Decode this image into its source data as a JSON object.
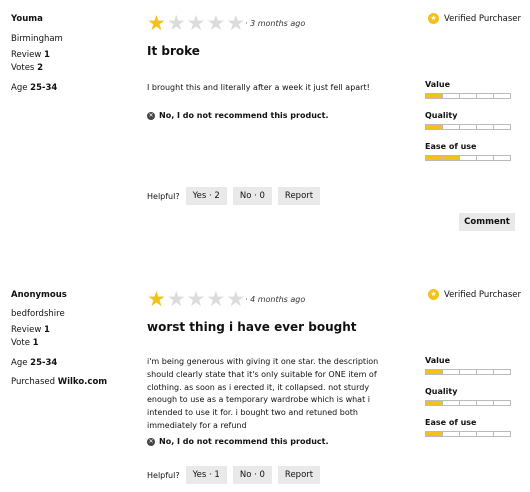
{
  "reviews": [
    {
      "author": "Youma",
      "location": "Birmingham",
      "review_label": "Review",
      "review_count": "1",
      "votes_label": "Votes",
      "votes_count": "2",
      "age_label": "Age",
      "age_value": "25-34",
      "rating": 1,
      "rating_max": 5,
      "time_ago": "· 3 months ago",
      "verified_label": "Verified Purchaser",
      "title": "It broke",
      "body": "I brought this and literally after a week it just fell apart!",
      "recommendation": "No,  I do not recommend this product.",
      "sub_ratings": [
        {
          "label": "Value",
          "level": 1,
          "max": 5
        },
        {
          "label": "Quality",
          "level": 1,
          "max": 5
        },
        {
          "label": "Ease of use",
          "level": 2,
          "max": 5
        }
      ],
      "helpful_label": "Helpful?",
      "yes_label": "Yes · 2",
      "no_label": "No · 0",
      "report_label": "Report",
      "comment_label": "Comment"
    },
    {
      "author": "Anonymous",
      "location": "bedfordshire",
      "review_label": "Review",
      "review_count": "1",
      "votes_label": "Vote",
      "votes_count": "1",
      "age_label": "Age",
      "age_value": "25-34",
      "purchased_label": "Purchased",
      "purchased_value": "Wilko.com",
      "rating": 1,
      "rating_max": 5,
      "time_ago": "· 4 months ago",
      "verified_label": "Verified Purchaser",
      "title": "worst thing i have ever bought",
      "body": "i'm being generous with giving it one star. the description should clearly state that it's only suitable for ONE item of clothing. as soon as i erected it, it collapsed. not sturdy enough to use as a temporary wardrobe which is what i intended to use it for. i bought two and retuned both immediately for a refund",
      "recommendation": "No,  I do not recommend this product.",
      "sub_ratings": [
        {
          "label": "Value",
          "level": 1,
          "max": 5
        },
        {
          "label": "Quality",
          "level": 1,
          "max": 5
        },
        {
          "label": "Ease of use",
          "level": 1,
          "max": 5
        }
      ],
      "helpful_label": "Helpful?",
      "yes_label": "Yes · 1",
      "no_label": "No · 0",
      "report_label": "Report"
    }
  ],
  "colors": {
    "star_on": "#f4c11b",
    "star_off": "#dcdcdc",
    "button_bg": "#e9e9e9"
  },
  "icons": {
    "verified": "verified-star-icon",
    "not_recommended": "x-circle-icon"
  }
}
